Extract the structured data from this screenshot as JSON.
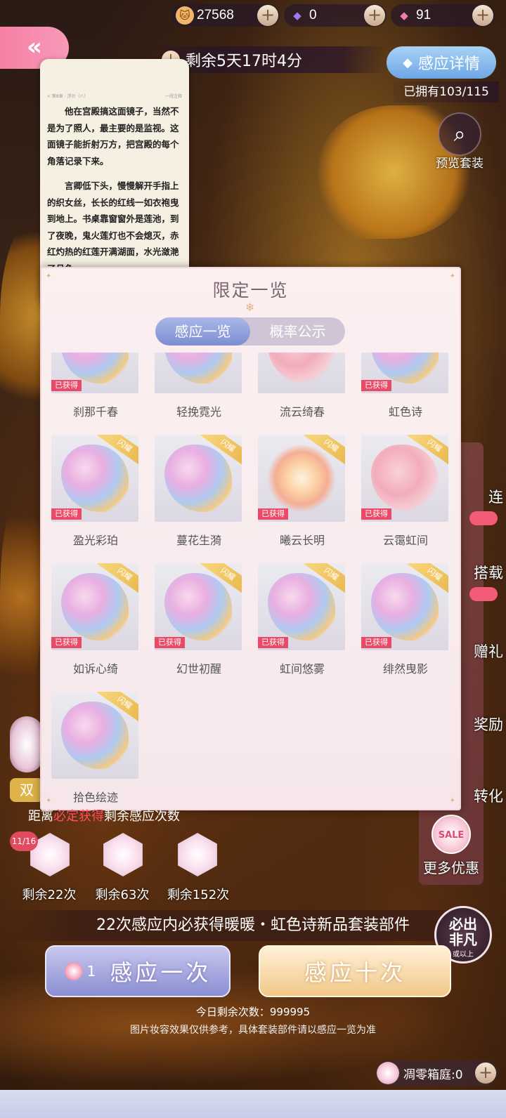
{
  "currency": [
    {
      "icon": "cat-coin-icon",
      "value": "27568",
      "color": "#f2b56a"
    },
    {
      "icon": "purple-diamond-icon",
      "value": "0",
      "color": "#9a7cf0"
    },
    {
      "icon": "pink-diamond-icon",
      "value": "91",
      "color": "#f27ab0"
    }
  ],
  "timer": {
    "text": "剩余5天17时4分"
  },
  "detail_button": {
    "label": "感应详情"
  },
  "owned": "已拥有103/115",
  "preview": {
    "label": "预览套装"
  },
  "book": {
    "header_left": "< 第8章 · 浮台（八）",
    "header_right": "一段注释",
    "para1": "他在宫殿搞这面镜子，当然不是为了照人，最主要的是监视。这面镜子能折射万方，把宫殿的每个角落记录下来。",
    "para2": "言卿低下头，慢慢解开手指上的织女丝，长长的红线一如衣袍曳到地上。书桌靠窗窗外是莲池，到了夜晚，鬼火莲灯也不会熄灭，赤红灼热的红莲开满湖面，水光潋滟了月色。"
  },
  "side_menu": [
    "连",
    "搭载",
    "赠礼",
    "奖励",
    "转化"
  ],
  "more_deals": {
    "label": "更多优惠",
    "icon_text": "SALE"
  },
  "modal": {
    "title": "限定一览",
    "tabs": [
      "感应一览",
      "概率公示"
    ],
    "got_label": "已获得",
    "ribbon": "闪耀",
    "items": [
      {
        "name": "刹那千春",
        "got": true,
        "ribbon": false
      },
      {
        "name": "轻挽霓光",
        "got": false,
        "ribbon": false
      },
      {
        "name": "流云绮春",
        "got": false,
        "ribbon": false
      },
      {
        "name": "虹色诗",
        "got": true,
        "ribbon": false
      },
      {
        "name": "盈光彩珀",
        "got": true,
        "ribbon": true
      },
      {
        "name": "蔓花生漪",
        "got": false,
        "ribbon": true
      },
      {
        "name": "曦云长明",
        "got": true,
        "ribbon": true
      },
      {
        "name": "云霭虹间",
        "got": true,
        "ribbon": true
      },
      {
        "name": "如诉心绮",
        "got": true,
        "ribbon": true
      },
      {
        "name": "幻世初醒",
        "got": true,
        "ribbon": true
      },
      {
        "name": "虹间悠雾",
        "got": true,
        "ribbon": true
      },
      {
        "name": "绯然曳影",
        "got": true,
        "ribbon": true
      },
      {
        "name": "拾色绘迹",
        "got": false,
        "ribbon": true
      }
    ]
  },
  "pity": {
    "title_prefix": "距离",
    "title_red": "必定获得",
    "title_suffix": "剩余感应次数",
    "count_badge": "11/16",
    "remains": [
      "剩余22次",
      "剩余63次",
      "剩余152次"
    ]
  },
  "banner": "22次感应内必获得暖暖・虹色诗新品套装部件",
  "fate_badge": {
    "line1": "必出",
    "line2": "非凡",
    "line3": "或以上"
  },
  "pull_one": {
    "cost": "1",
    "label": "感应一次"
  },
  "pull_ten": {
    "label": "感应十次"
  },
  "today": "今日剩余次数：999995",
  "disclaimer": "图片妆容效果仅供参考，具体套装部件请以感应一览为准",
  "courtyard": {
    "label": "凋零箱庭:0"
  },
  "left_badge": "双"
}
